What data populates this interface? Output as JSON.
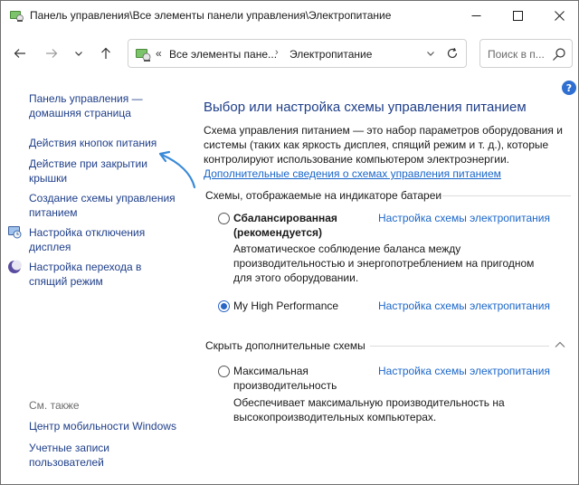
{
  "window": {
    "title": "Панель управления\\Все элементы панели управления\\Электропитание"
  },
  "nav": {
    "address_prefix": "«",
    "address_segment_1": "Все элементы пане...",
    "address_sep": "›",
    "address_segment_2": "Электропитание",
    "search_placeholder": "Поиск в п..."
  },
  "help": {
    "label": "?"
  },
  "left": {
    "home_line1": "Панель управления —",
    "home_line2": "домашняя страница",
    "power_buttons": "Действия кнопок питания",
    "lid_line1": "Действие при закрытии",
    "lid_line2": "крышки",
    "create_line1": "Создание схемы управления",
    "create_line2": "питанием",
    "display_line1": "Настройка отключения",
    "display_line2": "дисплея",
    "sleep_line1": "Настройка перехода в",
    "sleep_line2": "спящий режим",
    "see_also": "См. также",
    "mobility": "Центр мобильности Windows",
    "accounts_line1": "Учетные записи",
    "accounts_line2": "пользователей"
  },
  "main": {
    "title": "Выбор или настройка схемы управления питанием",
    "desc_line1": "Схема управления питанием — это набор параметров оборудования и",
    "desc_line2": "системы (таких как яркость дисплея, спящий режим и т. д.), которые",
    "desc_line3": "контролируют использование компьютером электроэнергии.",
    "more_link": "Дополнительные сведения о схемах управления питанием",
    "battery_section": "Схемы, отображаемые на индикаторе батареи",
    "hidden_section": "Скрыть дополнительные схемы"
  },
  "plans": {
    "balanced": {
      "name_line1": "Сбалансированная",
      "name_line2": "(рекомендуется)",
      "settings": "Настройка схемы электропитания",
      "desc_line1": "Автоматическое соблюдение баланса между",
      "desc_line2": "производительностью и энергопотреблением на пригодном",
      "desc_line3": "для этого оборудовании.",
      "selected": false
    },
    "high": {
      "name": "My High Performance",
      "settings": "Настройка схемы электропитания",
      "selected": true
    },
    "ultimate": {
      "name_line1": "Максимальная",
      "name_line2": "производительность",
      "settings": "Настройка схемы электропитания",
      "desc_line1": "Обеспечивает максимальную производительность на",
      "desc_line2": "высокопроизводительных компьютерах.",
      "selected": false
    }
  },
  "colors": {
    "link": "#1f3f8a",
    "accent": "#2a64c5",
    "arrow": "#3a8ad8"
  }
}
